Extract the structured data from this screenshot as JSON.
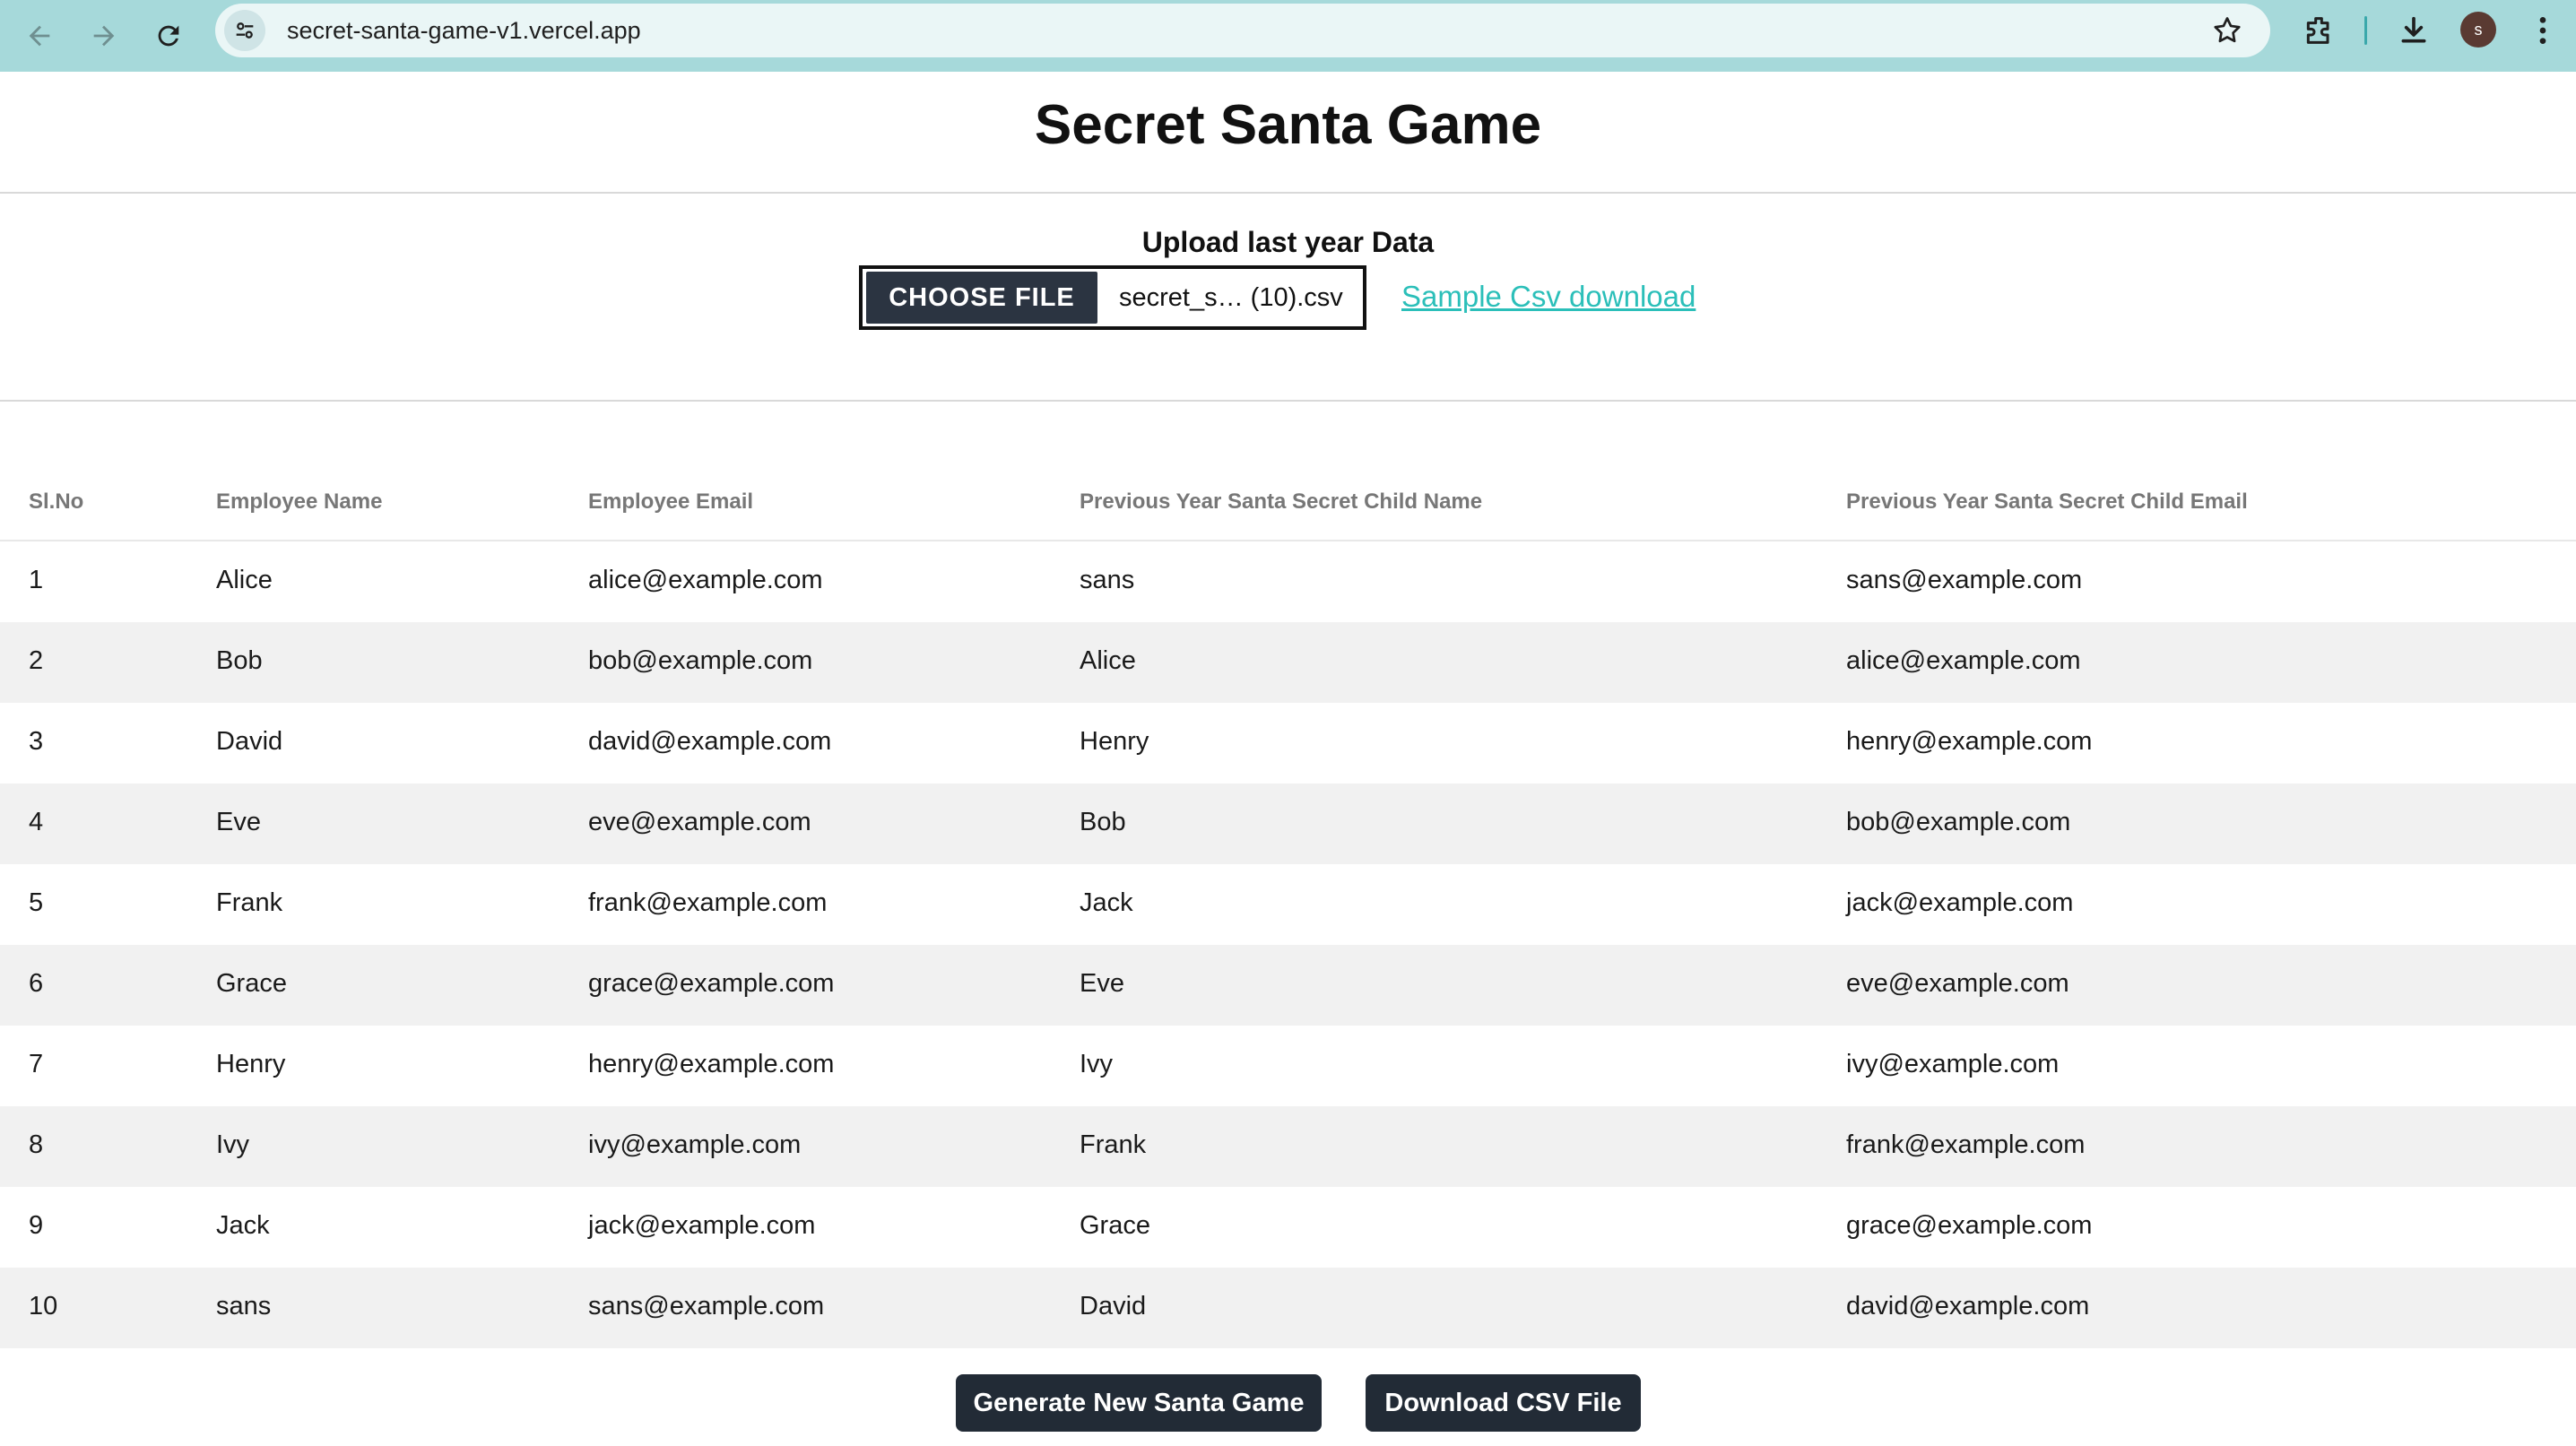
{
  "browser": {
    "url": "secret-santa-game-v1.vercel.app",
    "avatar_letter": "s",
    "colors": {
      "toolbar": "#a6d9da",
      "omnibox": "#eaf6f6"
    }
  },
  "page": {
    "title": "Secret Santa Game",
    "upload_label": "Upload last year Data",
    "choose_file_label": "CHOOSE FILE",
    "file_name": "secret_s… (10).csv",
    "sample_link": "Sample Csv download"
  },
  "table": {
    "headers": {
      "slno": "Sl.No",
      "name": "Employee Name",
      "email": "Employee Email",
      "child_name": "Previous Year Santa Secret Child Name",
      "child_email": "Previous Year Santa Secret Child Email"
    },
    "rows": [
      {
        "slno": "1",
        "name": "Alice",
        "email": "alice@example.com",
        "child_name": "sans",
        "child_email": "sans@example.com"
      },
      {
        "slno": "2",
        "name": "Bob",
        "email": "bob@example.com",
        "child_name": "Alice",
        "child_email": "alice@example.com"
      },
      {
        "slno": "3",
        "name": "David",
        "email": "david@example.com",
        "child_name": "Henry",
        "child_email": "henry@example.com"
      },
      {
        "slno": "4",
        "name": "Eve",
        "email": "eve@example.com",
        "child_name": "Bob",
        "child_email": "bob@example.com"
      },
      {
        "slno": "5",
        "name": "Frank",
        "email": "frank@example.com",
        "child_name": "Jack",
        "child_email": "jack@example.com"
      },
      {
        "slno": "6",
        "name": "Grace",
        "email": "grace@example.com",
        "child_name": "Eve",
        "child_email": "eve@example.com"
      },
      {
        "slno": "7",
        "name": "Henry",
        "email": "henry@example.com",
        "child_name": "Ivy",
        "child_email": "ivy@example.com"
      },
      {
        "slno": "8",
        "name": "Ivy",
        "email": "ivy@example.com",
        "child_name": "Frank",
        "child_email": "frank@example.com"
      },
      {
        "slno": "9",
        "name": "Jack",
        "email": "jack@example.com",
        "child_name": "Grace",
        "child_email": "grace@example.com"
      },
      {
        "slno": "10",
        "name": "sans",
        "email": "sans@example.com",
        "child_name": "David",
        "child_email": "david@example.com"
      }
    ]
  },
  "actions": {
    "generate_label": "Generate New Santa Game",
    "download_label": "Download CSV File"
  }
}
